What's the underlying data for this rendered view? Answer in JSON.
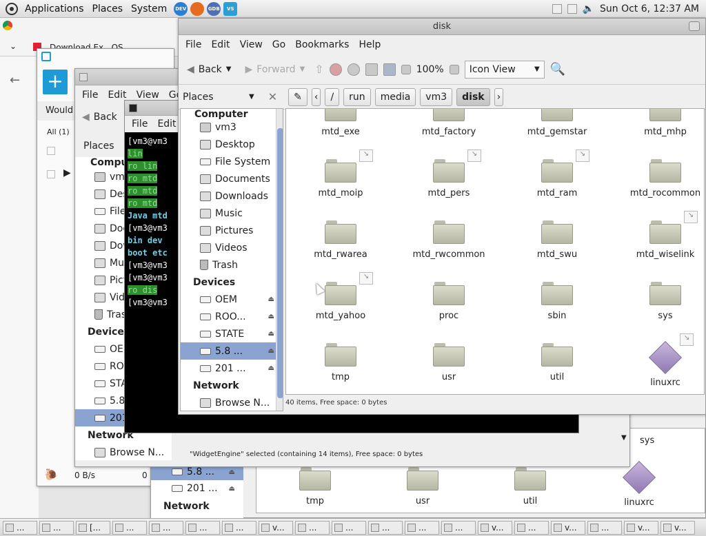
{
  "top_panel": {
    "menus": [
      "Applications",
      "Places",
      "System"
    ],
    "launchers": [
      "DEV",
      "firefox",
      "GDB",
      "VS"
    ],
    "clock": "Sun Oct  6, 12:37 AM"
  },
  "back_browser": {
    "tab_label": "Download   Ex...OS",
    "row_text": "Would",
    "filter": "All (1)",
    "speed": "0 B/s",
    "speed_right": "0"
  },
  "back_fm": {
    "menus": [
      "File",
      "Edit",
      "View",
      "Go"
    ],
    "back": "Back",
    "places": "Places",
    "computer": "Computer",
    "items": [
      "vm3",
      "Desktop",
      "File System",
      "Documents",
      "Downloads",
      "Music",
      "Pictures",
      "Videos",
      "Trash"
    ],
    "devices": "Devices",
    "device_items": [
      "OEM",
      "ROO...",
      "STATE",
      "5.8 ...",
      "201 ..."
    ],
    "network": "Network",
    "browse": "Browse N...",
    "status": "\"WidgetEngine\" selected (containing 14 items), Free space: 0 bytes"
  },
  "back_fm_lower": {
    "files": [
      "tmp",
      "usr",
      "util",
      "linuxrc"
    ],
    "sys": "sys",
    "device_items": [
      "5.8 ...",
      "201 ..."
    ],
    "network": "Network"
  },
  "terminal": {
    "menus": [
      "File",
      "Edit"
    ],
    "lines": [
      {
        "a": "[vm3@vm3 ",
        "b": ""
      },
      {
        "a": "    ",
        "b": "lin",
        "hl": true
      },
      {
        "a": "ro ",
        "b": "lin",
        "hl2": true
      },
      {
        "a": "ro ",
        "b": "mtd",
        "hl2": true
      },
      {
        "a": "ro ",
        "b": "mtd",
        "hl2": true
      },
      {
        "a": "ro ",
        "b": "mtd",
        "hl2": true
      },
      {
        "a": "Java ",
        "b": "mtd"
      },
      {
        "a": "[vm3@vm3 ",
        "b": ""
      },
      {
        "a": "bin  ",
        "b": "dev"
      },
      {
        "a": "boot ",
        "b": "etc"
      },
      {
        "a": "[vm3@vm3 ",
        "b": ""
      },
      {
        "a": "[vm3@vm3 ",
        "b": ""
      },
      {
        "a": "ro ",
        "b": "dis",
        "hl2": true
      },
      {
        "a": "[vm3@vm3 ",
        "b": ""
      }
    ]
  },
  "file_manager": {
    "title": "disk",
    "menus": [
      "File",
      "Edit",
      "View",
      "Go",
      "Bookmarks",
      "Help"
    ],
    "back": "Back",
    "forward": "Forward",
    "zoom": "100%",
    "view_mode": "Icon View",
    "places_label": "Places",
    "breadcrumbs": [
      "/",
      "run",
      "media",
      "vm3",
      "disk"
    ],
    "sidebar": {
      "computer": "Computer",
      "items": [
        "vm3",
        "Desktop",
        "File System",
        "Documents",
        "Downloads",
        "Music",
        "Pictures",
        "Videos",
        "Trash"
      ],
      "devices": "Devices",
      "device_items": [
        "OEM",
        "ROO...",
        "STATE",
        "5.8 ...",
        "201 ..."
      ],
      "network": "Network",
      "browse": "Browse N..."
    },
    "files": [
      {
        "name": "mtd_exe",
        "link": false
      },
      {
        "name": "mtd_factory",
        "link": false
      },
      {
        "name": "mtd_gemstar",
        "link": false
      },
      {
        "name": "mtd_mhp",
        "link": false
      },
      {
        "name": "mtd_moip",
        "link": true
      },
      {
        "name": "mtd_pers",
        "link": true
      },
      {
        "name": "mtd_ram",
        "link": true
      },
      {
        "name": "mtd_rocommon",
        "link": false
      },
      {
        "name": "mtd_rwarea",
        "link": false
      },
      {
        "name": "mtd_rwcommon",
        "link": false
      },
      {
        "name": "mtd_swu",
        "link": false
      },
      {
        "name": "mtd_wiselink",
        "link": true
      },
      {
        "name": "mtd_yahoo",
        "link": true
      },
      {
        "name": "proc",
        "link": false
      },
      {
        "name": "sbin",
        "link": false
      },
      {
        "name": "sys",
        "link": false
      },
      {
        "name": "tmp",
        "link": false
      },
      {
        "name": "usr",
        "link": false
      },
      {
        "name": "util",
        "link": false
      },
      {
        "name": "linuxrc",
        "link": true,
        "file": true
      }
    ],
    "status": "40 items, Free space: 0 bytes"
  },
  "taskbar": {
    "items": [
      "...",
      "...",
      "[...",
      "...",
      "...",
      "...",
      "...",
      "v...",
      "...",
      "...",
      "...",
      "...",
      "...",
      "v...",
      "...",
      "v...",
      "...",
      "v...",
      "v..."
    ]
  }
}
